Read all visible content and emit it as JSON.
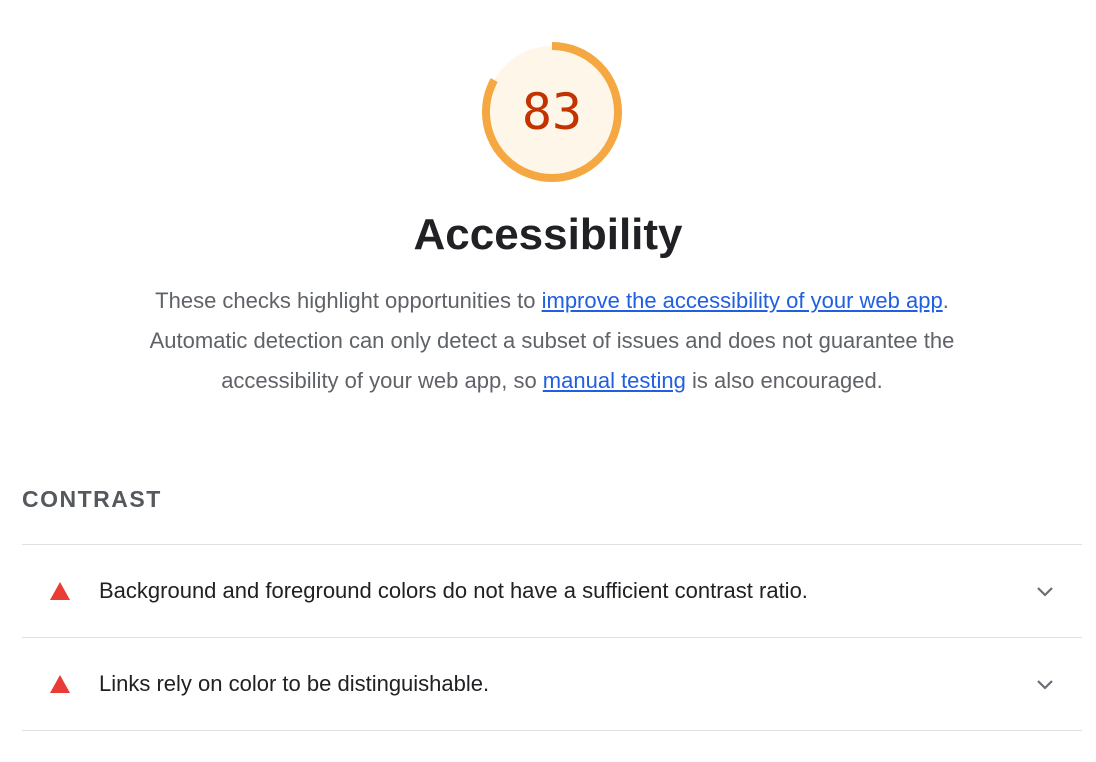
{
  "score": {
    "value": "83",
    "fraction": 0.83,
    "arc_color": "#f5a742",
    "fill_color": "#fff6ea",
    "text_color": "#c33300"
  },
  "category": {
    "title": "Accessibility",
    "description": {
      "text_1": "These checks highlight opportunities to ",
      "link_1": "improve the accessibility of your web app",
      "text_2": ". Automatic detection can only detect a subset of issues and does not guarantee the accessibility of your web app, so ",
      "link_2": "manual testing",
      "text_3": " is also encouraged."
    }
  },
  "group": {
    "title": "CONTRAST",
    "audits": [
      {
        "status_icon": "fail-triangle-icon",
        "label": "Background and foreground colors do not have a sufficient contrast ratio."
      },
      {
        "status_icon": "fail-triangle-icon",
        "label": "Links rely on color to be distinguishable."
      }
    ]
  },
  "colors": {
    "fail": "#eb3b36",
    "link": "#1f5fe0"
  }
}
